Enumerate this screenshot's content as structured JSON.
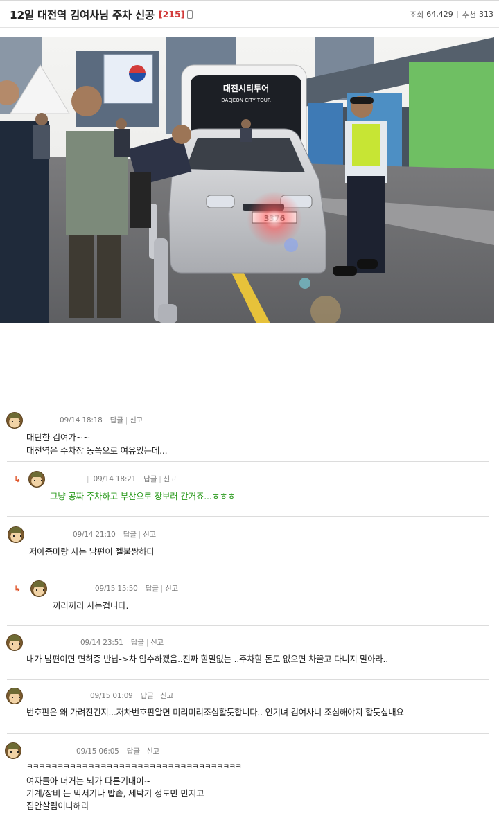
{
  "post": {
    "title": "12일 대전역 김여사님 주차 신공",
    "comment_count": "[215]",
    "views_label": "조회",
    "views": "64,429",
    "recommend_label": "추천",
    "recommend": "313"
  },
  "photo": {
    "bus_sign_1": "대전시티투어",
    "bus_sign_2": "DAEJEON CITY TOUR",
    "plate": "3376"
  },
  "comments": [
    {
      "datetime": "09/14 18:18",
      "reply": "답글",
      "report": "신고",
      "lines": [
        "대단한 김여가~~",
        "대전역은 주차장 동쪽으로 여유있는데..."
      ]
    },
    {
      "is_reply": true,
      "datetime": "09/14 18:21",
      "reply": "답글",
      "report": "신고",
      "lines": [
        "그냥 공짜 주차하고 부산으로 장보러 간거죠...ㅎㅎㅎ"
      ],
      "green": true
    },
    {
      "datetime": "09/14 21:10",
      "reply": "답글",
      "report": "신고",
      "lines": [
        "저아줌마랑 사는 남편이 젤불쌍하다"
      ]
    },
    {
      "is_reply": true,
      "datetime": "09/15 15:50",
      "reply": "답글",
      "report": "신고",
      "lines": [
        "끼리끼리 사는겁니다."
      ]
    },
    {
      "datetime": "09/14 23:51",
      "reply": "답글",
      "report": "신고",
      "lines": [
        "내가 남편이면 면허증 반납->차 압수하겠음..진짜 할말없는 ..주차할 돈도 없으면 차끌고 다니지 말아라.."
      ]
    },
    {
      "datetime": "09/15 01:09",
      "reply": "답글",
      "report": "신고",
      "lines": [
        "번호판은 왜 가려진건지...저차번호판알면 미리미리조심할듯합니다.. 인기녀 김여사니 조심해야지 할듯싶내요"
      ]
    },
    {
      "datetime": "09/15 06:05",
      "reply": "답글",
      "report": "신고",
      "lines": [
        "ㅋㅋㅋㅋㅋㅋㅋㅋㅋㅋㅋㅋㅋㅋㅋㅋㅋㅋㅋㅋㅋㅋㅋㅋㅋㅋㅋㅋㅋㅋㅋㅋㅋㅋㅋ",
        "여자들아 너거는 뇌가 다른기대이~",
        "기계/장비 는 믹서기나 밥솥, 세탁기 정도만 만지고",
        "집안살림이나해라"
      ]
    }
  ]
}
